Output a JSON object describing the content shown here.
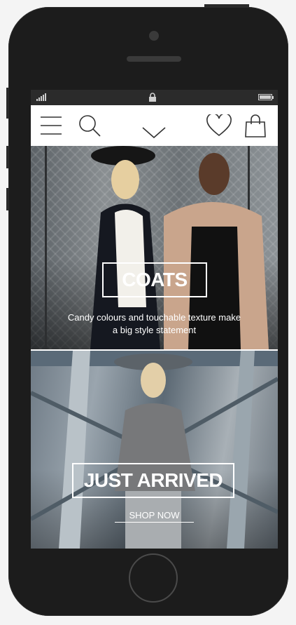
{
  "icons": {
    "signal": "signal-icon",
    "lock": "lock-icon",
    "battery": "battery-icon",
    "menu": "menu-icon",
    "search": "search-icon",
    "dropdown": "chevron-down-icon",
    "wishlist": "heart-icon",
    "bag": "shopping-bag-icon"
  },
  "banners": [
    {
      "title": "COATS",
      "subtitle_line1": "Candy colours and touchable texture make",
      "subtitle_line2": "a big style statement"
    },
    {
      "title": "JUST ARRIVED",
      "cta": "SHOP NOW"
    }
  ]
}
